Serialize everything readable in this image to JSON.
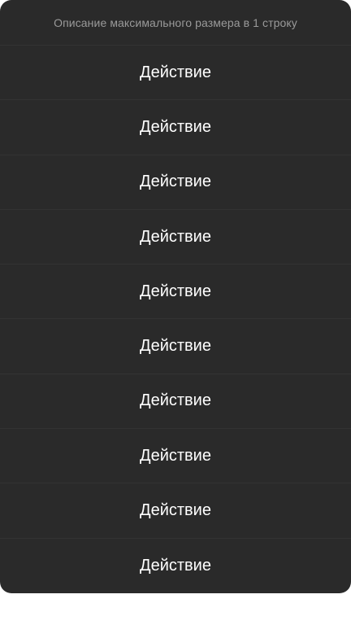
{
  "sheet": {
    "description": "Описание максимального размера в 1 строку",
    "actions": [
      {
        "label": "Действие"
      },
      {
        "label": "Действие"
      },
      {
        "label": "Действие"
      },
      {
        "label": "Действие"
      },
      {
        "label": "Действие"
      },
      {
        "label": "Действие"
      },
      {
        "label": "Действие"
      },
      {
        "label": "Действие"
      },
      {
        "label": "Действие"
      },
      {
        "label": "Действие"
      }
    ]
  },
  "colors": {
    "sheet_background": "#2a2a2a",
    "description_text": "#9a9a9a",
    "action_text": "#ffffff",
    "separator": "#333333"
  }
}
